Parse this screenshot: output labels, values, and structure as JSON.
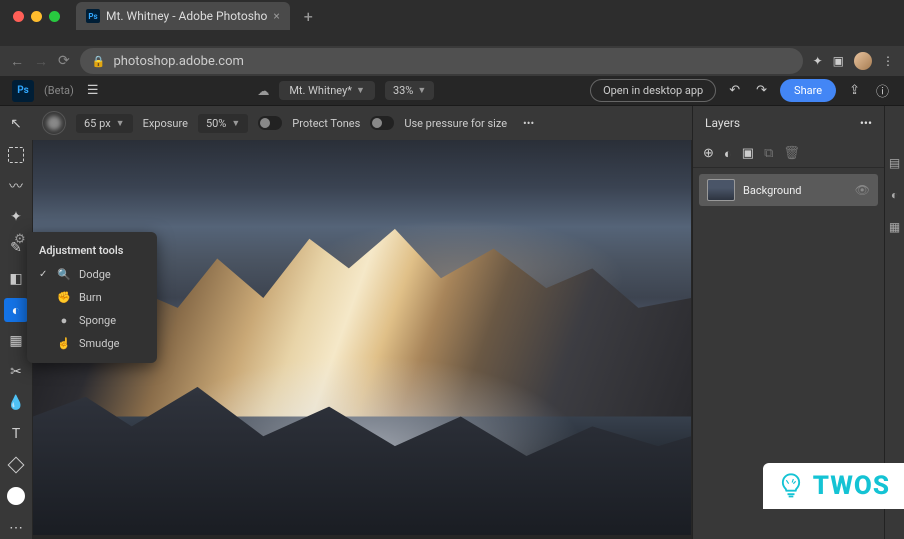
{
  "browser": {
    "tab_title": "Mt. Whitney - Adobe Photosho",
    "url": "photoshop.adobe.com"
  },
  "app": {
    "logo": "Ps",
    "beta": "(Beta)",
    "doc_name": "Mt. Whitney*",
    "zoom": "33%",
    "open_desktop": "Open in desktop app",
    "share": "Share"
  },
  "options": {
    "brush_size": "65 px",
    "exposure_label": "Exposure",
    "exposure_value": "50%",
    "protect_tones": "Protect Tones",
    "pressure_size": "Use pressure for size"
  },
  "popup": {
    "title": "Adjustment tools",
    "items": [
      "Dodge",
      "Burn",
      "Sponge",
      "Smudge"
    ],
    "selected": "Dodge"
  },
  "layers": {
    "title": "Layers",
    "background": "Background"
  },
  "watermark": {
    "text": "TWOS"
  }
}
